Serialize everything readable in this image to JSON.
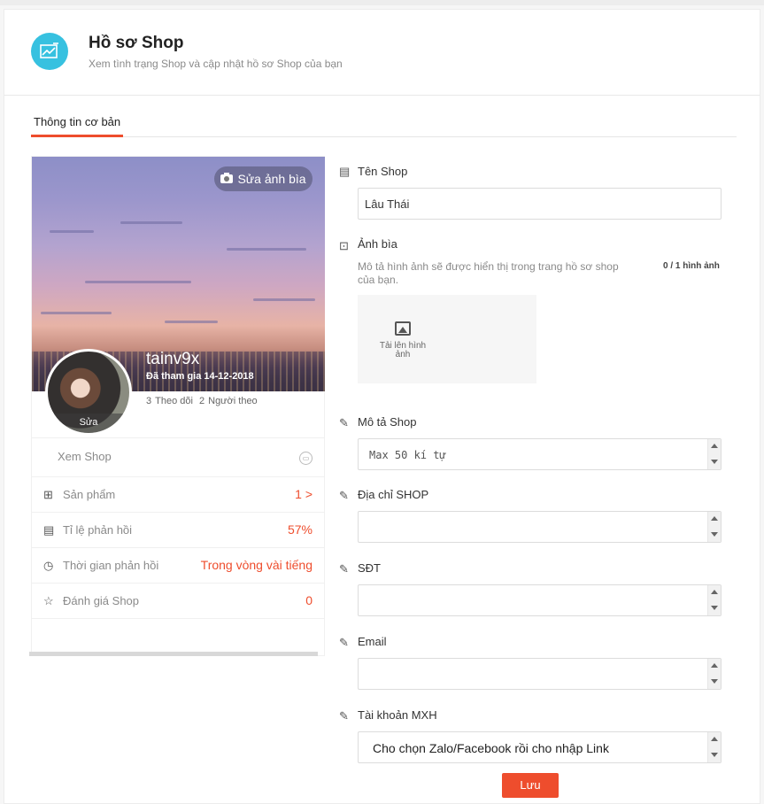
{
  "header": {
    "title": "Hồ sơ Shop",
    "subtitle": "Xem tình trạng Shop và cập nhật hồ sơ Shop của bạn"
  },
  "tabs": [
    {
      "label": "Thông tin cơ bản",
      "active": true
    }
  ],
  "profile": {
    "edit_cover_label": "Sửa ảnh bìa",
    "shop_name": "tainv9x",
    "join_date": "Đã tham gia 14-12-2018",
    "following_count": "3",
    "following_label": "Theo dõi",
    "followers_count": "2",
    "followers_label": "Người theo",
    "avatar_edit_label": "Sửa",
    "view_shop_label": "Xem Shop",
    "stats": [
      {
        "icon": "gift-icon",
        "label": "Sản phẩm",
        "value": "1 >"
      },
      {
        "icon": "chat-icon",
        "label": "Tỉ lệ phản hồi",
        "value": "57%"
      },
      {
        "icon": "clock-icon",
        "label": "Thời gian phản hồi",
        "value": "Trong vòng vài tiếng"
      },
      {
        "icon": "star-icon",
        "label": "Đánh giá Shop",
        "value": "0"
      }
    ]
  },
  "form": {
    "shop_name_label": "Tên Shop",
    "shop_name_value": "Lâu Thái",
    "cover_label": "Ảnh bìa",
    "cover_description": "Mô tả hình ảnh sẽ được hiển thị trong trang hồ sơ shop của bạn.",
    "cover_count": "0 / 1 hình ảnh",
    "upload_label": "Tải lên hình ảnh",
    "description_label": "Mô tả Shop",
    "description_value": "Max 50 kí tự",
    "address_label": "Địa chỉ SHOP",
    "address_value": "",
    "phone_label": "SĐT",
    "phone_value": "",
    "email_label": "Email",
    "email_value": "",
    "social_label": "Tài khoản MXH",
    "social_value": "Cho chọn Zalo/Facebook rồi cho nhập Link",
    "save_label": "Lưu"
  },
  "colors": {
    "accent": "#ee4d2d",
    "header_icon": "#37c1e0"
  }
}
